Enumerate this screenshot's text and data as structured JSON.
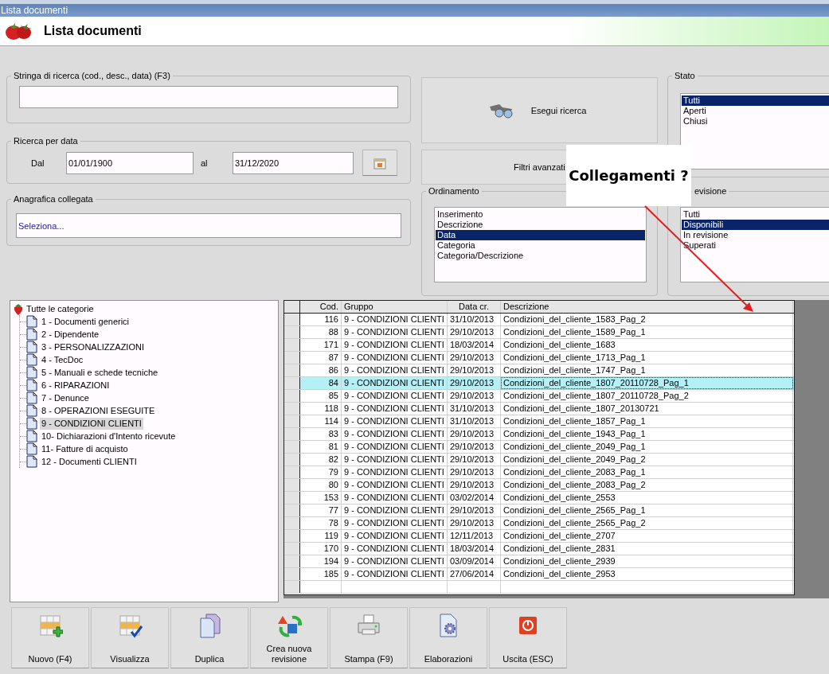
{
  "window": {
    "title": "Lista documenti"
  },
  "header": {
    "title": "Lista documenti"
  },
  "search": {
    "legend": "Stringa di ricerca (cod., desc., data) (F3)"
  },
  "date_search": {
    "legend": "Ricerca per data",
    "from_label": "Dal",
    "from_value": "01/01/1900",
    "to_label": "al",
    "to_value": "31/12/2020"
  },
  "linked_registry": {
    "legend": "Anagrafica collegata",
    "value": "Seleziona..."
  },
  "actions": {
    "search_button": "Esegui ricerca",
    "advanced_filters_button": "Filtri avanzati"
  },
  "sort": {
    "legend": "Ordinamento",
    "options": [
      {
        "label": "Inserimento",
        "selected": false
      },
      {
        "label": "Descrizione",
        "selected": false
      },
      {
        "label": "Data",
        "selected": true
      },
      {
        "label": "Categoria",
        "selected": false
      },
      {
        "label": "Categoria/Descrizione",
        "selected": false
      }
    ]
  },
  "status": {
    "legend": "Stato",
    "options": [
      {
        "label": "Tutti",
        "selected": true
      },
      {
        "label": "Aperti",
        "selected": false
      },
      {
        "label": "Chiusi",
        "selected": false
      }
    ]
  },
  "revision": {
    "legend": "evisione",
    "options": [
      {
        "label": "Tutti",
        "selected": false
      },
      {
        "label": "Disponibili",
        "selected": true
      },
      {
        "label": "In revisione",
        "selected": false
      },
      {
        "label": "Superati",
        "selected": false
      }
    ]
  },
  "tree": {
    "label": "Tutte le categorie",
    "children": [
      {
        "label": "1 - Documenti generici",
        "selected": false
      },
      {
        "label": "2 - Dipendente",
        "selected": false
      },
      {
        "label": "3 - PERSONALIZZAZIONI",
        "selected": false
      },
      {
        "label": "4 - TecDoc",
        "selected": false
      },
      {
        "label": "5 - Manuali e schede tecniche",
        "selected": false
      },
      {
        "label": "6 - RIPARAZIONI",
        "selected": false
      },
      {
        "label": "7 - Denunce",
        "selected": false
      },
      {
        "label": "8 - OPERAZIONI ESEGUITE",
        "selected": false
      },
      {
        "label": "9 - CONDIZIONI CLIENTI",
        "selected": true
      },
      {
        "label": "10- Dichiarazioni d'Intento ricevute",
        "selected": false
      },
      {
        "label": "11- Fatture di acquisto",
        "selected": false
      },
      {
        "label": "12 - Documenti CLIENTI",
        "selected": false
      }
    ]
  },
  "table": {
    "columns": [
      "Cod.",
      "Gruppo",
      "Data cr.",
      "Descrizione"
    ],
    "rows": [
      {
        "cells": [
          "116",
          "9 - CONDIZIONI CLIENTI",
          "31/10/2013",
          "Condizioni_del_cliente_1583_Pag_2"
        ],
        "selected": false
      },
      {
        "cells": [
          "88",
          "9 - CONDIZIONI CLIENTI",
          "29/10/2013",
          "Condizioni_del_cliente_1589_Pag_1"
        ],
        "selected": false
      },
      {
        "cells": [
          "171",
          "9 - CONDIZIONI CLIENTI",
          "18/03/2014",
          "Condizioni_del_cliente_1683"
        ],
        "selected": false
      },
      {
        "cells": [
          "87",
          "9 - CONDIZIONI CLIENTI",
          "29/10/2013",
          "Condizioni_del_cliente_1713_Pag_1"
        ],
        "selected": false
      },
      {
        "cells": [
          "86",
          "9 - CONDIZIONI CLIENTI",
          "29/10/2013",
          "Condizioni_del_cliente_1747_Pag_1"
        ],
        "selected": false
      },
      {
        "cells": [
          "84",
          "9 - CONDIZIONI CLIENTI",
          "29/10/2013",
          "Condizioni_del_cliente_1807_20110728_Pag_1"
        ],
        "selected": true
      },
      {
        "cells": [
          "85",
          "9 - CONDIZIONI CLIENTI",
          "29/10/2013",
          "Condizioni_del_cliente_1807_20110728_Pag_2"
        ],
        "selected": false
      },
      {
        "cells": [
          "118",
          "9 - CONDIZIONI CLIENTI",
          "31/10/2013",
          "Condizioni_del_cliente_1807_20130721"
        ],
        "selected": false
      },
      {
        "cells": [
          "114",
          "9 - CONDIZIONI CLIENTI",
          "31/10/2013",
          "Condizioni_del_cliente_1857_Pag_1"
        ],
        "selected": false
      },
      {
        "cells": [
          "83",
          "9 - CONDIZIONI CLIENTI",
          "29/10/2013",
          "Condizioni_del_cliente_1943_Pag_1"
        ],
        "selected": false
      },
      {
        "cells": [
          "81",
          "9 - CONDIZIONI CLIENTI",
          "29/10/2013",
          "Condizioni_del_cliente_2049_Pag_1"
        ],
        "selected": false
      },
      {
        "cells": [
          "82",
          "9 - CONDIZIONI CLIENTI",
          "29/10/2013",
          "Condizioni_del_cliente_2049_Pag_2"
        ],
        "selected": false
      },
      {
        "cells": [
          "79",
          "9 - CONDIZIONI CLIENTI",
          "29/10/2013",
          "Condizioni_del_cliente_2083_Pag_1"
        ],
        "selected": false
      },
      {
        "cells": [
          "80",
          "9 - CONDIZIONI CLIENTI",
          "29/10/2013",
          "Condizioni_del_cliente_2083_Pag_2"
        ],
        "selected": false
      },
      {
        "cells": [
          "153",
          "9 - CONDIZIONI CLIENTI",
          "03/02/2014",
          "Condizioni_del_cliente_2553"
        ],
        "selected": false
      },
      {
        "cells": [
          "77",
          "9 - CONDIZIONI CLIENTI",
          "29/10/2013",
          "Condizioni_del_cliente_2565_Pag_1"
        ],
        "selected": false
      },
      {
        "cells": [
          "78",
          "9 - CONDIZIONI CLIENTI",
          "29/10/2013",
          "Condizioni_del_cliente_2565_Pag_2"
        ],
        "selected": false
      },
      {
        "cells": [
          "119",
          "9 - CONDIZIONI CLIENTI",
          "12/11/2013",
          "Condizioni_del_cliente_2707"
        ],
        "selected": false
      },
      {
        "cells": [
          "170",
          "9 - CONDIZIONI CLIENTI",
          "18/03/2014",
          "Condizioni_del_cliente_2831"
        ],
        "selected": false
      },
      {
        "cells": [
          "194",
          "9 - CONDIZIONI CLIENTI",
          "03/09/2014",
          "Condizioni_del_cliente_2939"
        ],
        "selected": false
      },
      {
        "cells": [
          "185",
          "9 - CONDIZIONI CLIENTI",
          "27/06/2014",
          "Condizioni_del_cliente_2953"
        ],
        "selected": false
      }
    ]
  },
  "toolbar": [
    {
      "label": "Nuovo (F4)",
      "kind": "new"
    },
    {
      "label": "Visualizza",
      "kind": "view"
    },
    {
      "label": "Duplica",
      "kind": "duplicate"
    },
    {
      "label": "Crea nuova revisione",
      "kind": "revision"
    },
    {
      "label": "Stampa (F9)",
      "kind": "print"
    },
    {
      "label": "Elaborazioni",
      "kind": "process"
    },
    {
      "label": "Uscita (ESC)",
      "kind": "exit"
    }
  ],
  "annotation": {
    "text": "Collegamenti ?"
  }
}
